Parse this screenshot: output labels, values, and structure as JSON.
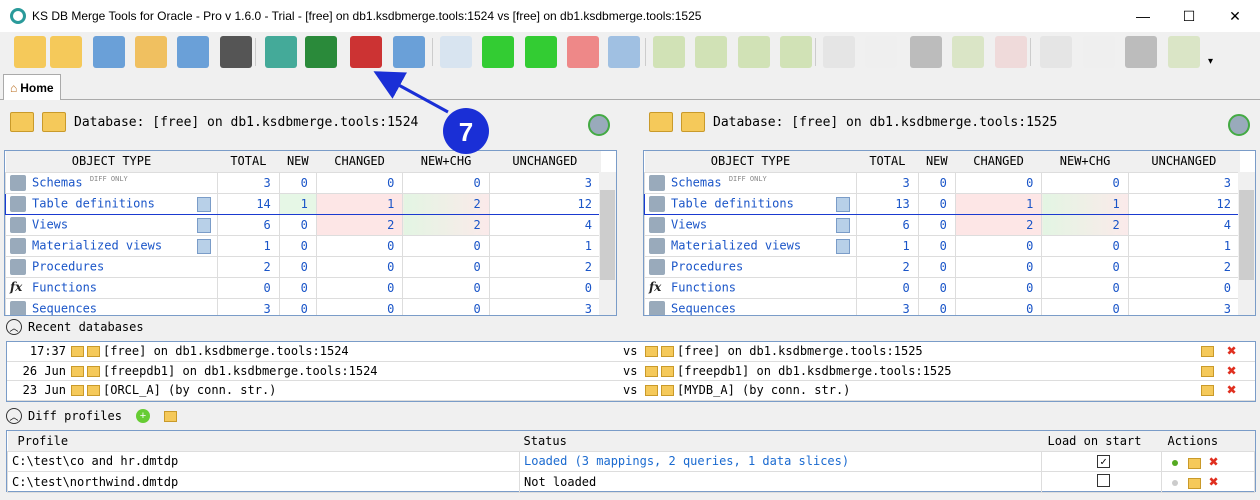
{
  "window": {
    "title": "KS DB Merge Tools for Oracle - Pro v 1.6.0 - Trial - [free] on db1.ksdbmerge.tools:1524 vs [free] on db1.ksdbmerge.tools:1525",
    "minimize": "—",
    "maximize": "☐",
    "close": "✕"
  },
  "toolbar": {
    "icons": [
      "open-database-icon",
      "favorite-database-icon",
      "tables-icon",
      "select-query-icon",
      "settings-list-icon",
      "binoculars-icon",
      "refresh-database-icon",
      "excel-export-icon",
      "script-settings-icon",
      "copy-document-icon",
      "grid-icon",
      "grid-green-icon",
      "grid-green-new-icon",
      "grid-red-icon",
      "grid-blue-icon",
      "move-down-icon",
      "move-down-alt-icon",
      "move-up-icon",
      "move-up-alt-icon",
      "checklist-icon",
      "document-icon",
      "document-gray-icon",
      "merge-right-icon",
      "delete-checklist-icon",
      "checklist-right-icon",
      "document-right-icon",
      "document-gray-right-icon",
      "merge-left-icon"
    ],
    "overflow": "▾"
  },
  "tab": {
    "label": "Home"
  },
  "annotation": {
    "number": "7",
    "color": "#1a2fd6"
  },
  "left": {
    "database": "Database: [free] on db1.ksdbmerge.tools:1524"
  },
  "right": {
    "database": "Database: [free] on db1.ksdbmerge.tools:1525"
  },
  "columns": [
    "OBJECT TYPE",
    "TOTAL",
    "NEW",
    "CHANGED",
    "NEW+CHG",
    "UNCHANGED"
  ],
  "left_rows": [
    {
      "name": "Schemas",
      "tag": "DIFF ONLY",
      "v": [
        "3",
        "0",
        "0",
        "0",
        "3"
      ]
    },
    {
      "name": "Table definitions",
      "v": [
        "14",
        "1",
        "1",
        "2",
        "12"
      ]
    },
    {
      "name": "Views",
      "v": [
        "6",
        "0",
        "2",
        "2",
        "4"
      ]
    },
    {
      "name": "Materialized views",
      "v": [
        "1",
        "0",
        "0",
        "0",
        "1"
      ]
    },
    {
      "name": "Procedures",
      "v": [
        "2",
        "0",
        "0",
        "0",
        "2"
      ]
    },
    {
      "name": "Functions",
      "v": [
        "0",
        "0",
        "0",
        "0",
        "0"
      ]
    },
    {
      "name": "Sequences",
      "v": [
        "3",
        "0",
        "0",
        "0",
        "3"
      ]
    }
  ],
  "right_rows": [
    {
      "name": "Schemas",
      "tag": "DIFF ONLY",
      "v": [
        "3",
        "0",
        "0",
        "0",
        "3"
      ]
    },
    {
      "name": "Table definitions",
      "v": [
        "13",
        "0",
        "1",
        "1",
        "12"
      ]
    },
    {
      "name": "Views",
      "v": [
        "6",
        "0",
        "2",
        "2",
        "4"
      ]
    },
    {
      "name": "Materialized views",
      "v": [
        "1",
        "0",
        "0",
        "0",
        "1"
      ]
    },
    {
      "name": "Procedures",
      "v": [
        "2",
        "0",
        "0",
        "0",
        "2"
      ]
    },
    {
      "name": "Functions",
      "v": [
        "0",
        "0",
        "0",
        "0",
        "0"
      ]
    },
    {
      "name": "Sequences",
      "v": [
        "3",
        "0",
        "0",
        "0",
        "3"
      ]
    }
  ],
  "recent": {
    "title": "Recent databases",
    "vs": "vs",
    "items": [
      {
        "time": "17:37",
        "left": "[free] on db1.ksdbmerge.tools:1524",
        "right": "[free] on db1.ksdbmerge.tools:1525"
      },
      {
        "time": "26 Jun",
        "left": "[freepdb1] on db1.ksdbmerge.tools:1524",
        "right": "[freepdb1] on db1.ksdbmerge.tools:1525"
      },
      {
        "time": "23 Jun",
        "left": "[ORCL_A] (by conn. str.)",
        "right": "[MYDB_A] (by conn. str.)"
      }
    ]
  },
  "profiles": {
    "title": "Diff profiles",
    "headers": [
      "Profile",
      "Status",
      "Load on start",
      "Actions"
    ],
    "items": [
      {
        "profile": "C:\\test\\co and hr.dmtdp",
        "status": "Loaded (3 mappings, 2 queries, 1 data slices)",
        "load_on_start": true
      },
      {
        "profile": "C:\\test\\northwind.dmtdp",
        "status": "Not loaded",
        "load_on_start": false
      }
    ]
  }
}
